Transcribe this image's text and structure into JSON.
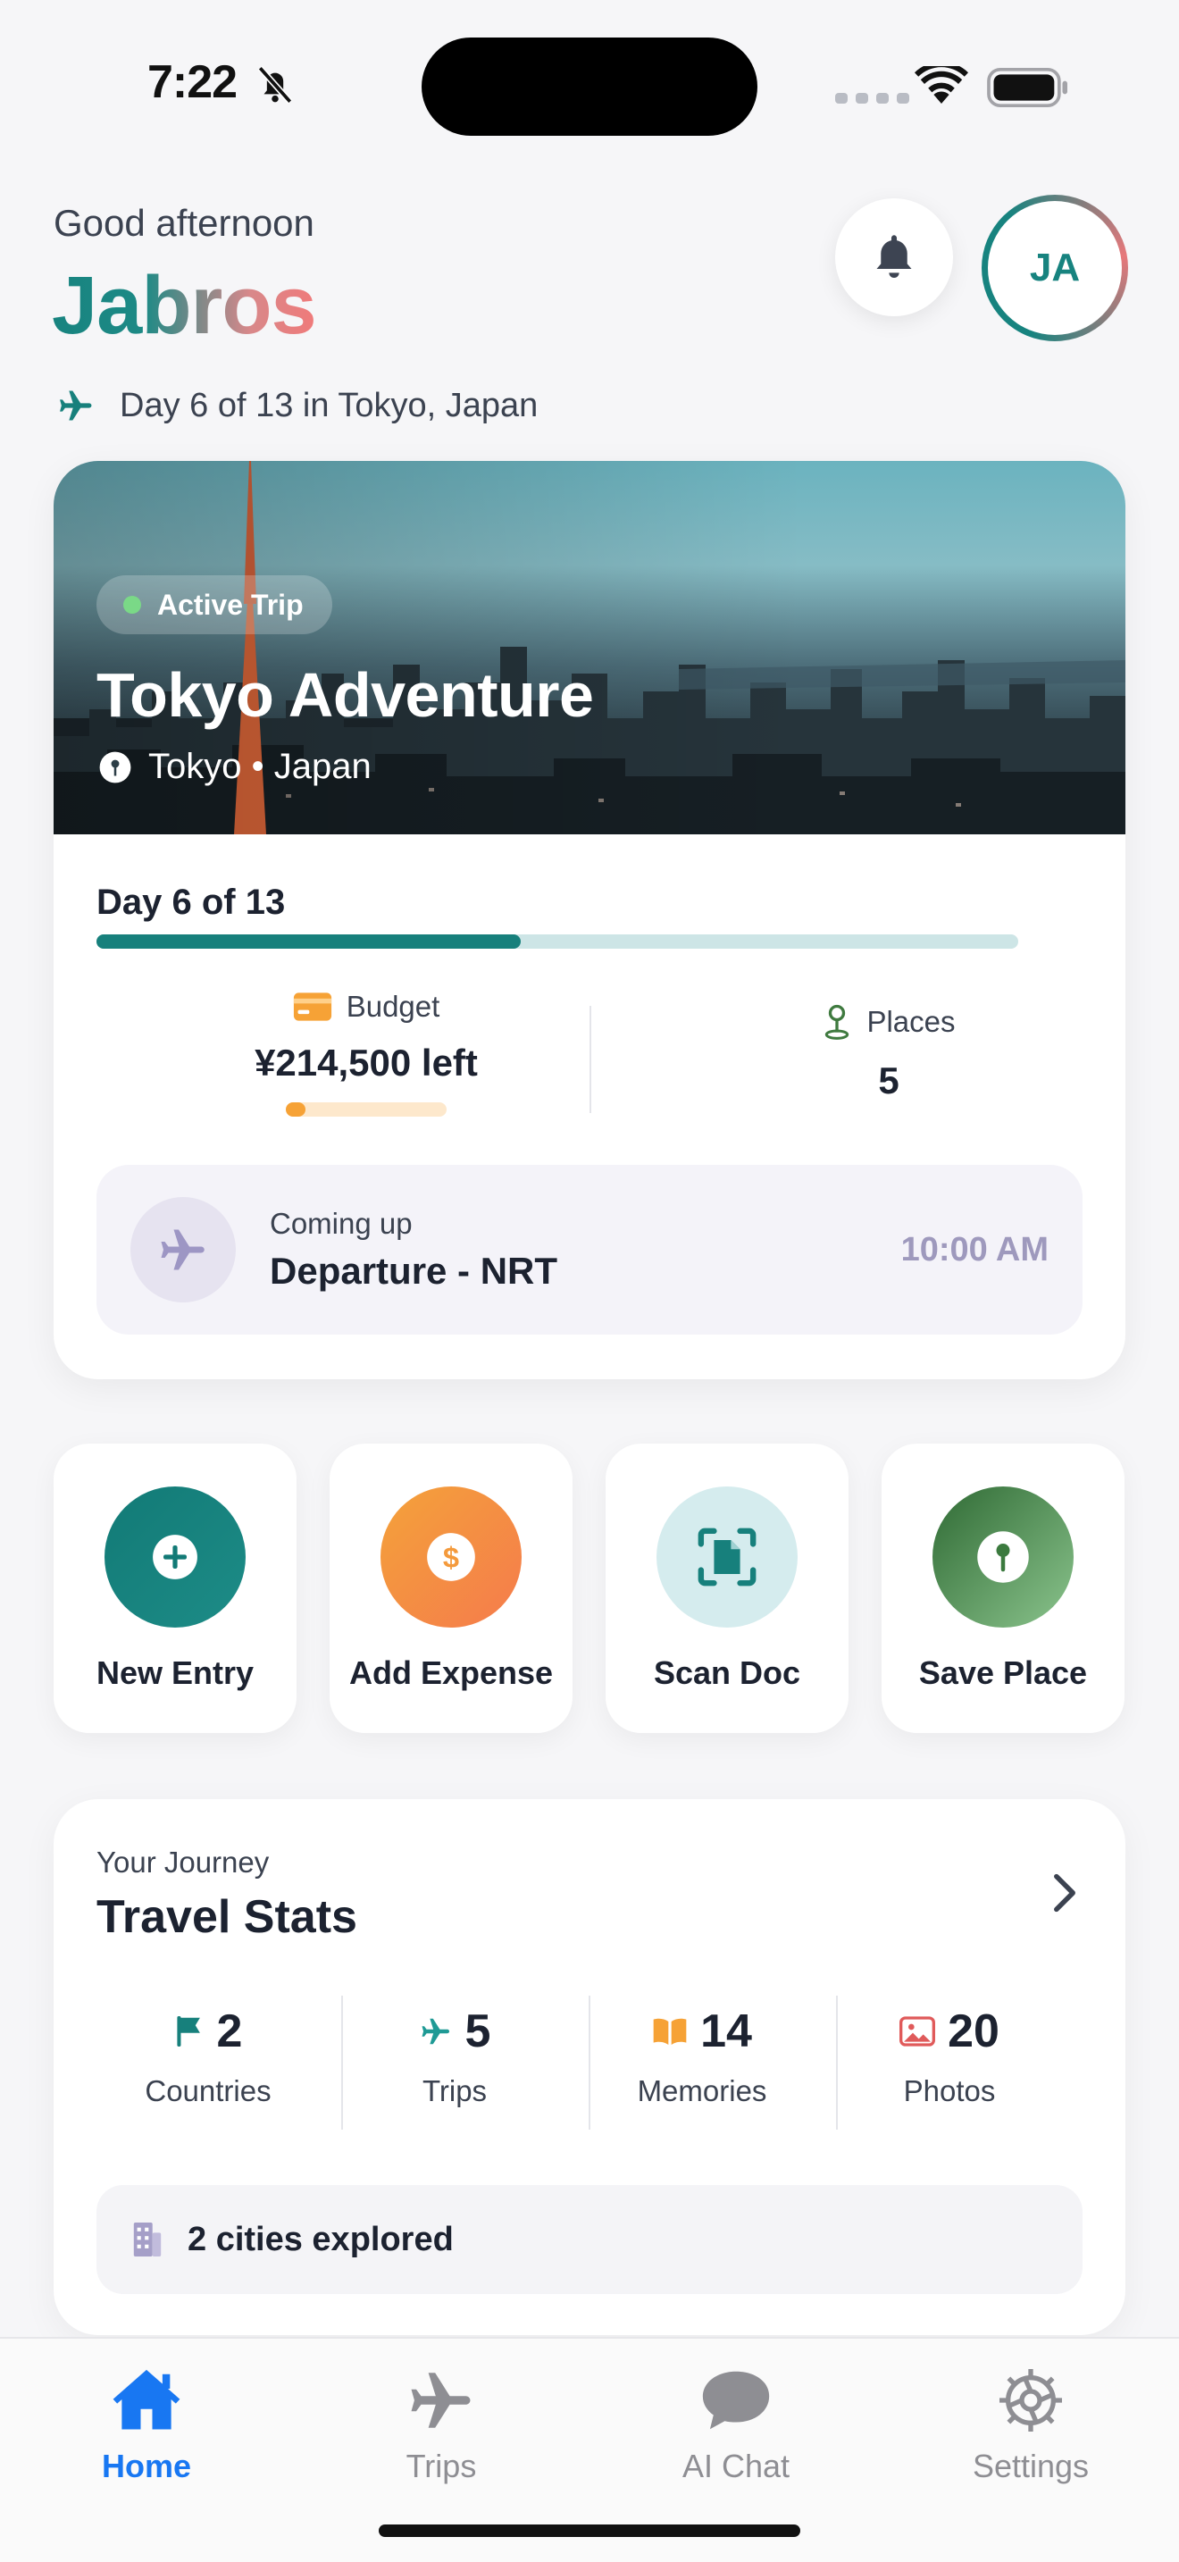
{
  "status_bar": {
    "time": "7:22"
  },
  "header": {
    "greeting": "Good afternoon",
    "brand": "Jabros",
    "avatar_initials": "JA",
    "trip_status": "Day 6 of 13 in Tokyo, Japan"
  },
  "trip_card": {
    "badge": "Active Trip",
    "title": "Tokyo Adventure",
    "location": "Tokyo • Japan",
    "day_label": "Day 6 of 13",
    "day_progress": 0.46,
    "budget": {
      "label": "Budget",
      "value": "¥214,500 left",
      "used_fraction": 0.12
    },
    "places": {
      "label": "Places",
      "value": "5"
    },
    "coming_up": {
      "label": "Coming up",
      "title": "Departure - NRT",
      "time": "10:00 AM"
    }
  },
  "quick_actions": [
    {
      "label": "New Entry",
      "icon": "plus-icon"
    },
    {
      "label": "Add Expense",
      "icon": "dollar-icon"
    },
    {
      "label": "Scan Doc",
      "icon": "scan-document-icon"
    },
    {
      "label": "Save Place",
      "icon": "pin-icon"
    }
  ],
  "stats": {
    "subtitle": "Your Journey",
    "title": "Travel Stats",
    "metrics": [
      {
        "value": "2",
        "label": "Countries",
        "icon": "flag-icon",
        "color": "#17807c"
      },
      {
        "value": "5",
        "label": "Trips",
        "icon": "plane-icon",
        "color": "#1f9a95"
      },
      {
        "value": "14",
        "label": "Memories",
        "icon": "book-icon",
        "color": "#f6a236"
      },
      {
        "value": "20",
        "label": "Photos",
        "icon": "photo-icon",
        "color": "#e05a5a"
      }
    ],
    "cities": "2 cities explored"
  },
  "tab_bar": [
    {
      "label": "Home",
      "icon": "home-icon",
      "active": true
    },
    {
      "label": "Trips",
      "icon": "plane-icon",
      "active": false
    },
    {
      "label": "AI Chat",
      "icon": "chat-bubble-icon",
      "active": false
    },
    {
      "label": "Settings",
      "icon": "gear-icon",
      "active": false
    }
  ],
  "colors": {
    "accent": "#17807c",
    "tab_active": "#1877f2",
    "budget": "#f6a236"
  }
}
